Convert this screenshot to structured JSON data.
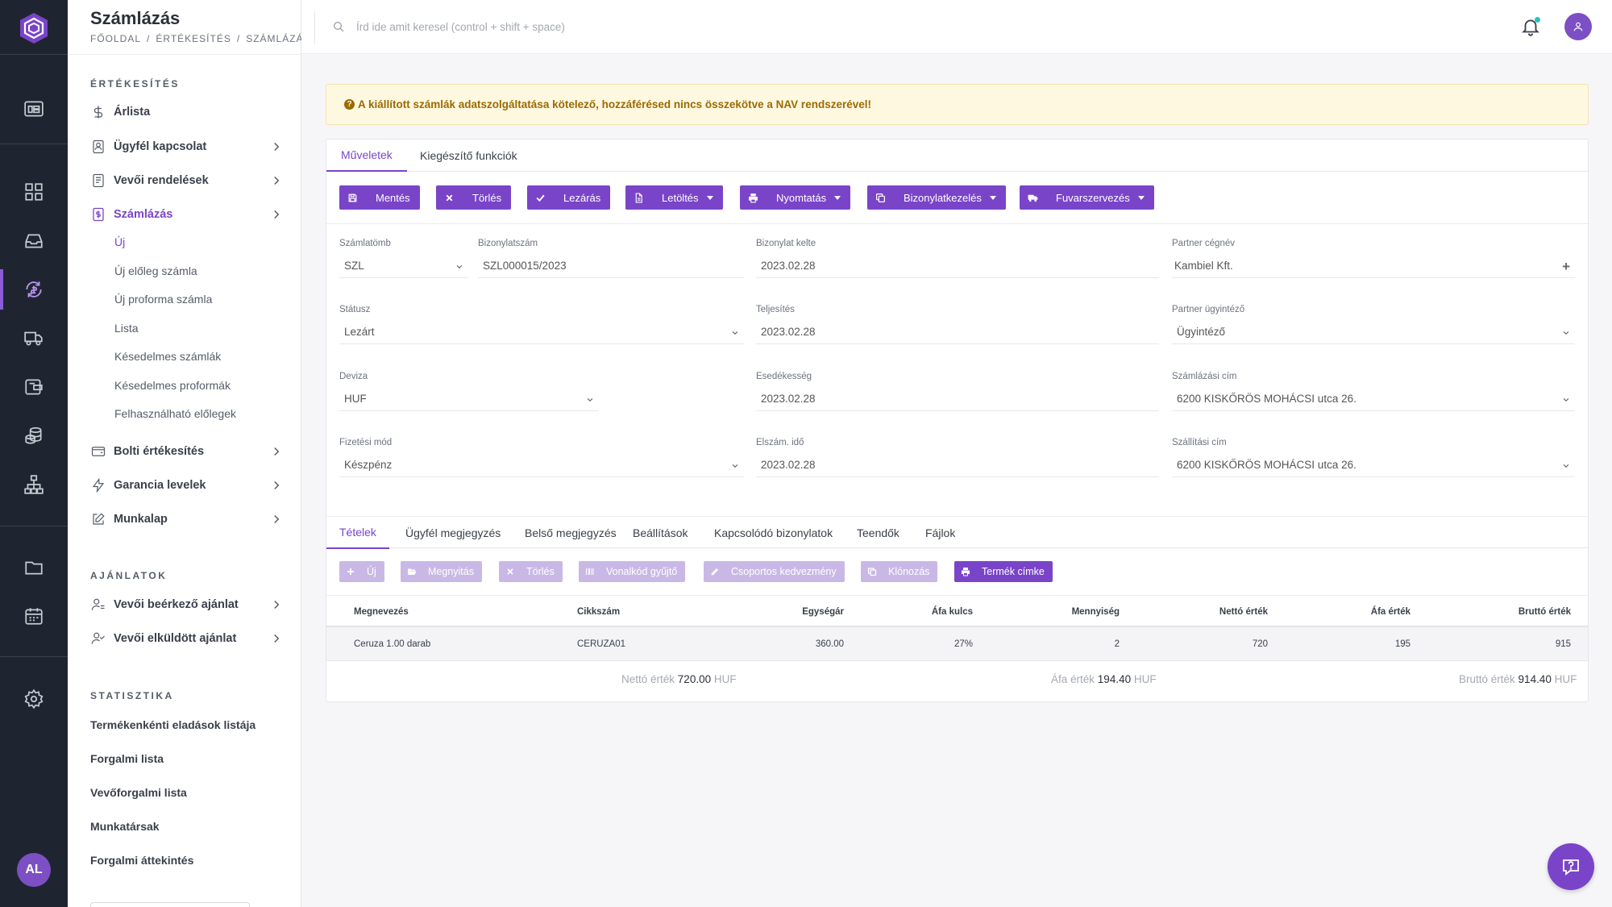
{
  "header": {
    "title": "Számlázás",
    "breadcrumb": [
      "FŐOLDAL",
      "ÉRTÉKESÍTÉS",
      "SZÁMLÁZÁS"
    ],
    "search_placeholder": "Írd ide amit keresel (control + shift + space)"
  },
  "rail": {
    "items": [
      "dashboard-icon",
      "grid-icon",
      "inbox-icon",
      "sync-icon",
      "truck-icon",
      "wallet-icon",
      "coins-icon",
      "hierarchy-icon",
      "folder-icon",
      "calendar-icon",
      "settings-icon"
    ],
    "active": "sync-icon",
    "user_initials": "AL"
  },
  "sidebar": {
    "sections": [
      {
        "title": "ÉRTÉKESÍTÉS",
        "items": [
          {
            "label": "Árlista"
          },
          {
            "label": "Ügyfél kapcsolat"
          },
          {
            "label": "Vevői rendelések"
          },
          {
            "label": "Számlázás",
            "active": true,
            "children": [
              "Új",
              "Új előleg számla",
              "Új proforma számla",
              "Lista",
              "Késedelmes számlák",
              "Késedelmes proformák",
              "Felhasználható előlegek"
            ]
          },
          {
            "label": "Bolti értékesítés"
          },
          {
            "label": "Garancia levelek"
          },
          {
            "label": "Munkalap"
          }
        ]
      },
      {
        "title": "AJÁNLATOK",
        "items": [
          {
            "label": "Vevői beérkező ajánlat"
          },
          {
            "label": "Vevői elküldött ajánlat"
          }
        ]
      },
      {
        "title": "STATISZTIKA",
        "items": [
          {
            "label": "Termékenkénti eladások listája"
          },
          {
            "label": "Forgalmi lista"
          },
          {
            "label": "Vevőforgalmi lista"
          },
          {
            "label": "Munkatársak"
          },
          {
            "label": "Forgalmi áttekintés"
          }
        ]
      }
    ]
  },
  "alert": {
    "text": "A kiállított számlák adatszolgáltatása kötelező, hozzáférésed nincs összekötve a NAV rendszerével!",
    "icon": "question-circle-icon",
    "color": "#9a6a00"
  },
  "main_tabs": [
    "Műveletek",
    "Kiegészítő funkciók"
  ],
  "actions": [
    {
      "label": "Mentés",
      "icon": "save-icon"
    },
    {
      "label": "Törlés",
      "icon": "x-icon"
    },
    {
      "label": "Lezárás",
      "icon": "check-icon"
    },
    {
      "label": "Letöltés",
      "icon": "file-icon"
    },
    {
      "label": "Nyomtatás",
      "icon": "printer-icon"
    },
    {
      "label": "Bizonylatkezelés",
      "icon": "copy-icon"
    },
    {
      "label": "Fuvarszervezés",
      "icon": "truck-icon"
    }
  ],
  "form": {
    "szamlatomb": {
      "label": "Számlatömb",
      "value": "SZL"
    },
    "bizonylatszam": {
      "label": "Bizonylatszám",
      "value": "SZL000015/2023"
    },
    "bizonylat_kelte": {
      "label": "Bizonylat kelte",
      "value": "2023.02.28"
    },
    "partner_cegnev": {
      "label": "Partner cégnév",
      "value": "Kambiel Kft."
    },
    "statusz": {
      "label": "Státusz",
      "value": "Lezárt"
    },
    "teljesites": {
      "label": "Teljesítés",
      "value": "2023.02.28"
    },
    "partner_ugyintezo": {
      "label": "Partner ügyintéző",
      "value": "Ügyintéző"
    },
    "deviza": {
      "label": "Deviza",
      "value": "HUF"
    },
    "esedekesseg": {
      "label": "Esedékesség",
      "value": "2023.02.28"
    },
    "szamlazasi_cim": {
      "label": "Számlázási cím",
      "value": "6200 KISKŐRÖS MOHÁCSI utca 26."
    },
    "fizetesi_mod": {
      "label": "Fizetési mód",
      "value": "Készpénz"
    },
    "elszam_ido": {
      "label": "Elszám. idő",
      "value": "2023.02.28"
    },
    "szallitasi_cim": {
      "label": "Szállítási cím",
      "value": "6200 KISKŐRÖS MOHÁCSI utca 26."
    }
  },
  "item_tabs": [
    "Tételek",
    "Ügyfél megjegyzés",
    "Belső megjegyzés",
    "Beállítások",
    "Kapcsolódó bizonylatok",
    "Teendők",
    "Fájlok"
  ],
  "item_actions": [
    {
      "label": "Új",
      "icon": "plus-icon"
    },
    {
      "label": "Megnyitás",
      "icon": "folder-open-icon"
    },
    {
      "label": "Törlés",
      "icon": "x-icon"
    },
    {
      "label": "Vonalkód gyűjtő",
      "icon": "barcode-icon"
    },
    {
      "label": "Csoportos kedvezmény",
      "icon": "pencil-icon"
    },
    {
      "label": "Klónozás",
      "icon": "copy-icon"
    },
    {
      "label": "Termék címke",
      "icon": "printer-icon"
    }
  ],
  "table": {
    "columns": [
      "Megnevezés",
      "Cikkszám",
      "Egységár",
      "Áfa kulcs",
      "Mennyiség",
      "Nettó érték",
      "Áfa érték",
      "Bruttó érték"
    ],
    "rows": [
      [
        "Ceruza 1.00 darab",
        "CERUZA01",
        "360.00",
        "27%",
        "2",
        "720",
        "195",
        "915"
      ]
    ]
  },
  "totals": {
    "netto": {
      "label": "Nettó érték",
      "value": "720.00",
      "currency": "HUF"
    },
    "afa": {
      "label": "Áfa érték",
      "value": "194.40",
      "currency": "HUF"
    },
    "brutto": {
      "label": "Bruttó érték",
      "value": "914.40",
      "currency": "HUF"
    }
  },
  "colors": {
    "accent": "#7a44c9",
    "rail_bg": "#1f2530",
    "alert_bg": "#fff8e1"
  }
}
